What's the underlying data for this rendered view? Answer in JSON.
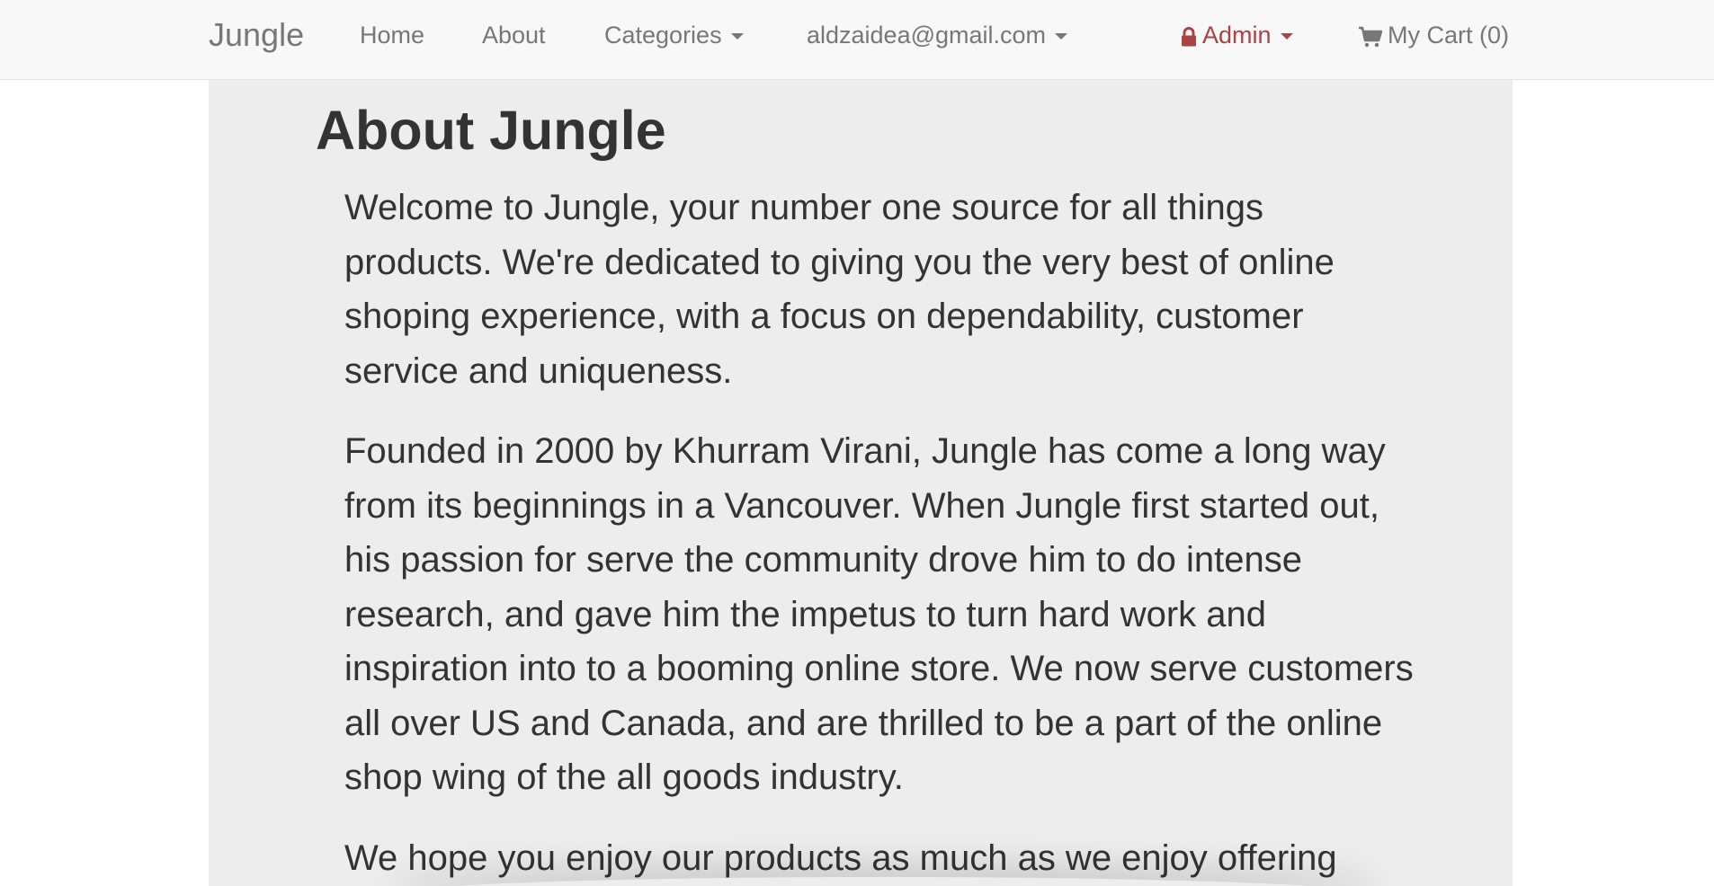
{
  "navbar": {
    "brand": "Jungle",
    "home": "Home",
    "about": "About",
    "categories": "Categories",
    "user_email": "aldzaidea@gmail.com",
    "admin": "Admin",
    "cart": "My Cart (0)"
  },
  "colors": {
    "navbar_bg": "#f8f8f8",
    "nav_text": "#777777",
    "admin_text": "#a94442",
    "content_bg": "#ededed",
    "body_text": "#333333"
  },
  "icons": {
    "admin": "lock-icon",
    "cart": "shopping-cart-icon",
    "dropdown": "caret-down-icon"
  },
  "main": {
    "title": "About Jungle",
    "paragraphs": [
      "Welcome to Jungle, your number one source for all things products. We're dedicated to giving you the very best of online shoping experience, with a focus on dependability, customer service and uniqueness.",
      "Founded in 2000 by Khurram Virani, Jungle has come a long way from its beginnings in a Vancouver. When Jungle first started out, his passion for serve the community drove him to do intense research, and gave him the impetus to turn hard work and inspiration into to a booming online store. We now serve customers all over US and Canada, and are thrilled to be a part of the online shop wing of the all goods industry.",
      "We hope you enjoy our products as much as we enjoy offering"
    ]
  }
}
